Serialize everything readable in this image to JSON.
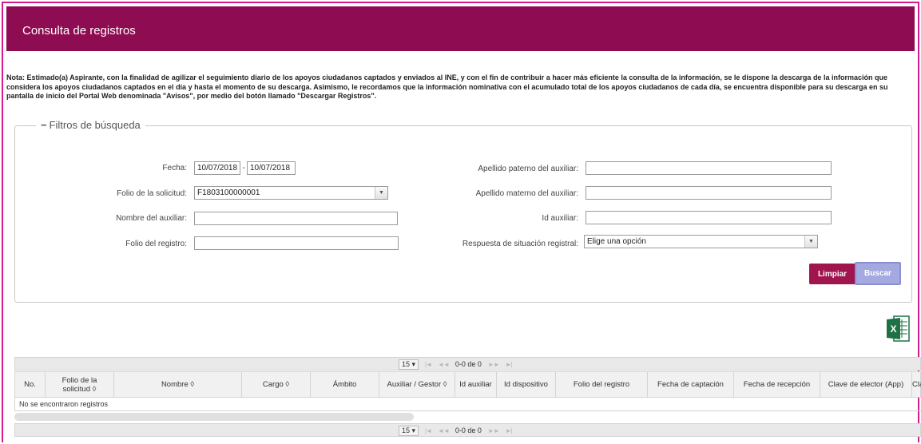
{
  "header": {
    "title": "Consulta de registros"
  },
  "note": "Nota: Estimado(a) Aspirante, con la finalidad de agilizar el seguimiento diario de los apoyos ciudadanos captados y enviados al INE, y con el fin de contribuir a hacer más eficiente la consulta de la información, se le dispone la descarga de la información que considera los apoyos ciudadanos captados en el día y hasta el momento de su descarga. Asimismo, le recordamos que la información nominativa con el acumulado total de los apoyos ciudadanos de cada día, se encuentra disponible para su descarga en su pantalla de inicio del Portal Web denominada \"Avisos\", por medio del botón llamado \"Descargar Registros\".",
  "filters": {
    "legend": "Filtros de búsqueda",
    "fecha_label": "Fecha:",
    "fecha_from": "10/07/2018",
    "fecha_sep": "-",
    "fecha_to": "10/07/2018",
    "folio_solicitud_label": "Folio de la solicitud:",
    "folio_solicitud_value": "F1803100000001",
    "nombre_aux_label": "Nombre del auxiliar:",
    "folio_registro_label": "Folio del registro:",
    "ap_paterno_label": "Apellido paterno del auxiliar:",
    "ap_materno_label": "Apellido materno del auxiliar:",
    "id_aux_label": "Id auxiliar:",
    "respuesta_label": "Respuesta de situación registral:",
    "respuesta_value": "Elige una opción",
    "limpiar_label": "Limpiar",
    "buscar_label": "Buscar"
  },
  "pager": {
    "page_size": "15",
    "first": "|◄",
    "prev": "◄◄",
    "range": "0-0 de 0",
    "next": "►►",
    "last": "►|"
  },
  "table": {
    "columns": [
      "No.",
      "Folio de la solicitud ◊",
      "Nombre ◊",
      "Cargo ◊",
      "Ámbito",
      "Auxiliar / Gestor ◊",
      "Id auxiliar",
      "Id dispositivo",
      "Folio del registro",
      "Fecha de captación",
      "Fecha de recepción",
      "Clave de elector (App)",
      "Cla"
    ],
    "empty_message": "No se encontraron registros"
  },
  "icons": {
    "excel": "excel-export-icon",
    "dropdown": "chevron-down-icon"
  },
  "colors": {
    "header": "#8e0d52",
    "limpiar": "#a1154e",
    "buscar": "#a4a9e0",
    "frame": "#d61b8c"
  }
}
